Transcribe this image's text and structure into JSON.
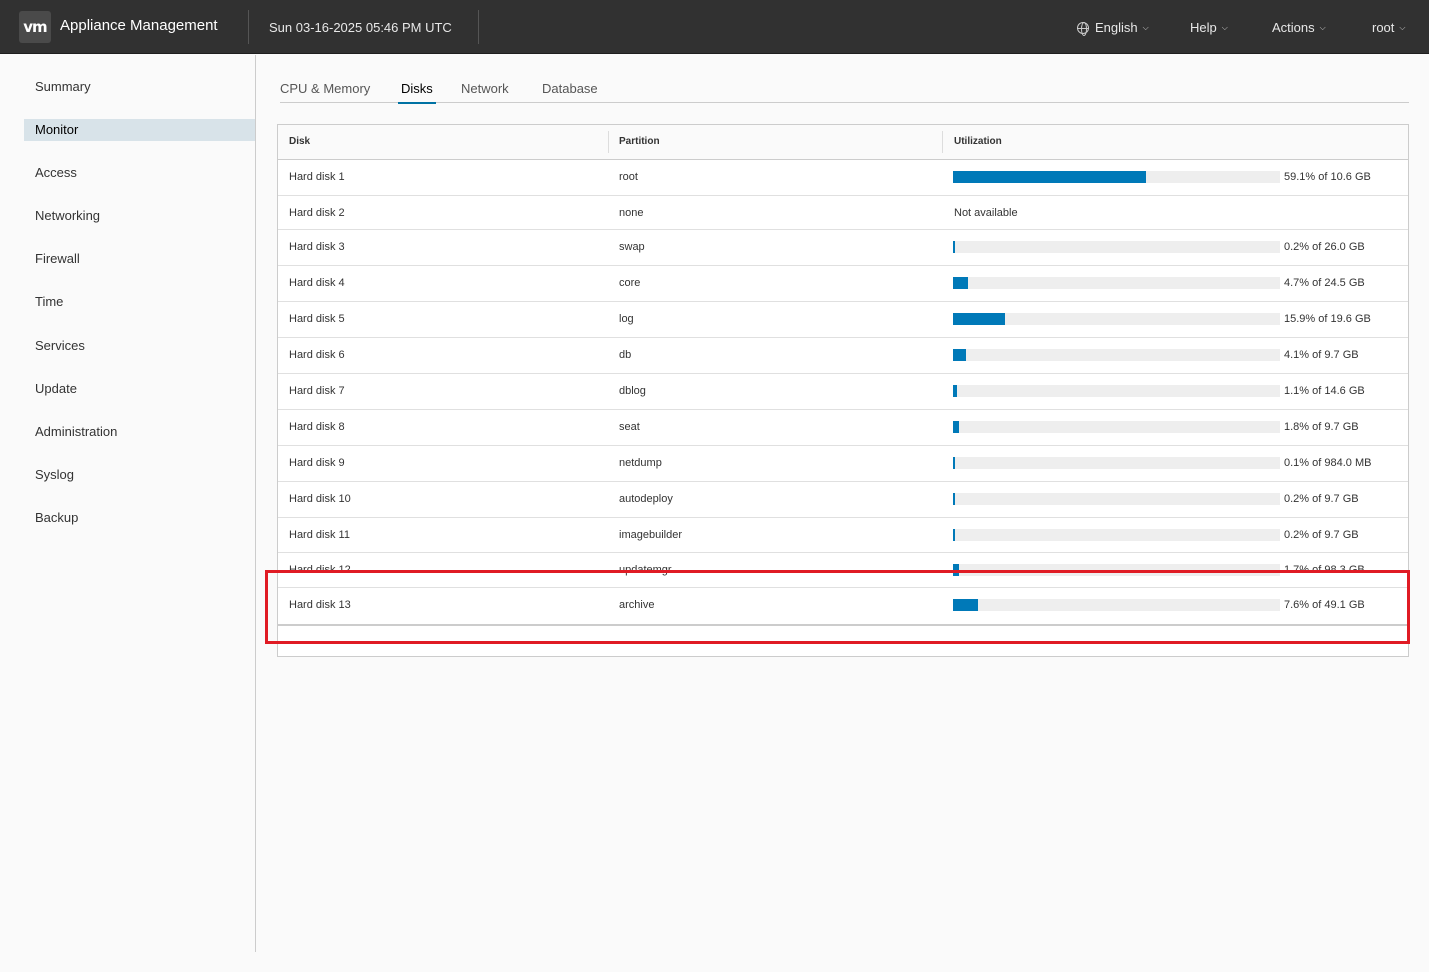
{
  "header": {
    "logo": "vm",
    "title": "Appliance Management",
    "datetime": "Sun 03-16-2025 05:46 PM UTC",
    "language": "English",
    "help": "Help",
    "actions": "Actions",
    "user": "root"
  },
  "sidebar": {
    "items": [
      {
        "label": "Summary"
      },
      {
        "label": "Monitor",
        "active": true
      },
      {
        "label": "Access"
      },
      {
        "label": "Networking"
      },
      {
        "label": "Firewall"
      },
      {
        "label": "Time"
      },
      {
        "label": "Services"
      },
      {
        "label": "Update"
      },
      {
        "label": "Administration"
      },
      {
        "label": "Syslog"
      },
      {
        "label": "Backup"
      }
    ]
  },
  "tabs": [
    {
      "label": "CPU & Memory"
    },
    {
      "label": "Disks",
      "active": true
    },
    {
      "label": "Network"
    },
    {
      "label": "Database"
    }
  ],
  "table": {
    "columns": [
      "Disk",
      "Partition",
      "Utilization"
    ],
    "rows": [
      {
        "disk": "Hard disk 1",
        "partition": "root",
        "percent": 59.1,
        "utilization": "59.1% of 10.6 GB"
      },
      {
        "disk": "Hard disk 2",
        "partition": "none",
        "percent": null,
        "utilization": "Not available"
      },
      {
        "disk": "Hard disk 3",
        "partition": "swap",
        "percent": 0.2,
        "utilization": "0.2% of 26.0 GB"
      },
      {
        "disk": "Hard disk 4",
        "partition": "core",
        "percent": 4.7,
        "utilization": "4.7% of 24.5 GB"
      },
      {
        "disk": "Hard disk 5",
        "partition": "log",
        "percent": 15.9,
        "utilization": "15.9% of 19.6 GB"
      },
      {
        "disk": "Hard disk 6",
        "partition": "db",
        "percent": 4.1,
        "utilization": "4.1% of 9.7 GB"
      },
      {
        "disk": "Hard disk 7",
        "partition": "dblog",
        "percent": 1.1,
        "utilization": "1.1% of 14.6 GB"
      },
      {
        "disk": "Hard disk 8",
        "partition": "seat",
        "percent": 1.8,
        "utilization": "1.8% of 9.7 GB"
      },
      {
        "disk": "Hard disk 9",
        "partition": "netdump",
        "percent": 0.1,
        "utilization": "0.1% of 984.0 MB"
      },
      {
        "disk": "Hard disk 10",
        "partition": "autodeploy",
        "percent": 0.2,
        "utilization": "0.2% of 9.7 GB"
      },
      {
        "disk": "Hard disk 11",
        "partition": "imagebuilder",
        "percent": 0.2,
        "utilization": "0.2% of 9.7 GB"
      },
      {
        "disk": "Hard disk 12",
        "partition": "updatemgr",
        "percent": 1.7,
        "utilization": "1.7% of 98.3 GB"
      },
      {
        "disk": "Hard disk 13",
        "partition": "archive",
        "percent": 7.6,
        "utilization": "7.6% of 49.1 GB"
      }
    ]
  },
  "colors": {
    "header_bg": "#313131",
    "accent": "#0079b8",
    "highlight": "#e01b24",
    "nav_active_bg": "#d8e3e9"
  }
}
